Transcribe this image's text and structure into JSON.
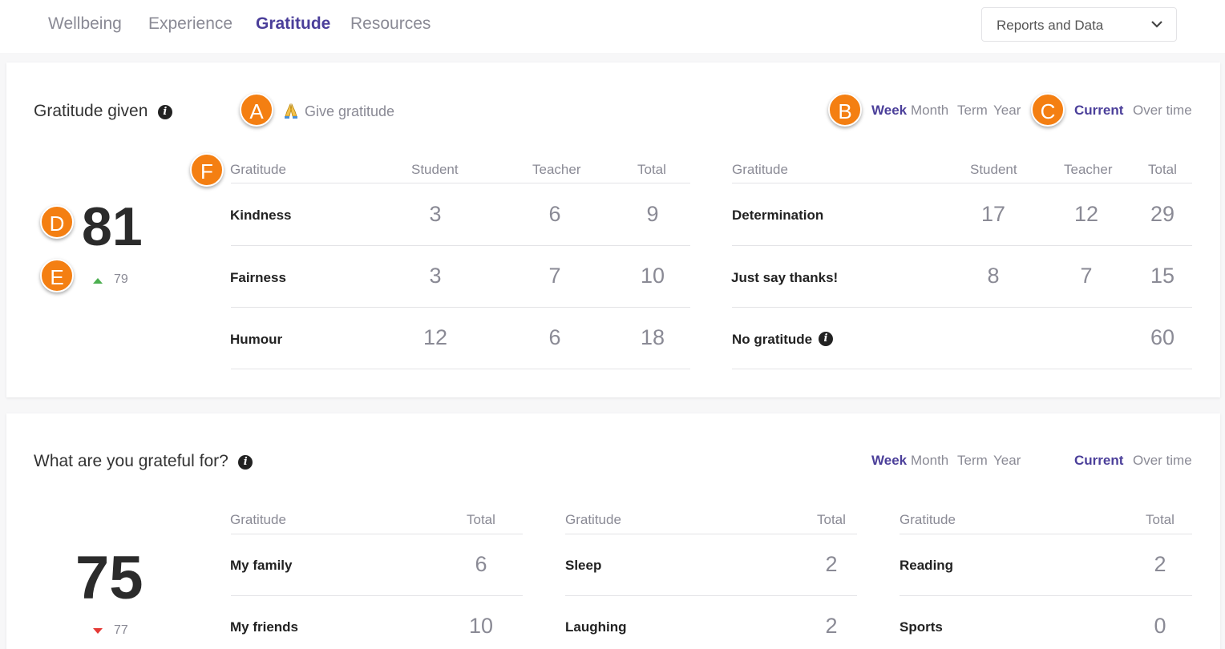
{
  "nav": {
    "tabs": [
      {
        "label": "Wellbeing",
        "active": false
      },
      {
        "label": "Experience",
        "active": false
      },
      {
        "label": "Gratitude",
        "active": true
      },
      {
        "label": "Resources",
        "active": false
      }
    ],
    "reports_dropdown": "Reports and Data"
  },
  "annotations": [
    "A",
    "B",
    "C",
    "D",
    "E",
    "F"
  ],
  "periods": [
    "Week",
    "Month",
    "Term",
    "Year"
  ],
  "modes": [
    "Current",
    "Over time"
  ],
  "gratitude_given": {
    "title": "Gratitude given",
    "give_label": "Give gratitude",
    "total": "81",
    "previous": "79",
    "trend": "up",
    "headers": [
      "Gratitude",
      "Student",
      "Teacher",
      "Total"
    ],
    "left_rows": [
      {
        "label": "Kindness",
        "student": "3",
        "teacher": "6",
        "total": "9"
      },
      {
        "label": "Fairness",
        "student": "3",
        "teacher": "7",
        "total": "10"
      },
      {
        "label": "Humour",
        "student": "12",
        "teacher": "6",
        "total": "18"
      }
    ],
    "right_rows": [
      {
        "label": "Determination",
        "student": "17",
        "teacher": "12",
        "total": "29"
      },
      {
        "label": "Just say thanks!",
        "student": "8",
        "teacher": "7",
        "total": "15"
      },
      {
        "label": "No gratitude",
        "student": "",
        "teacher": "",
        "total": "60"
      }
    ]
  },
  "grateful_for": {
    "title": "What are you grateful for?",
    "total": "75",
    "previous": "77",
    "trend": "down",
    "headers": [
      "Gratitude",
      "Total"
    ],
    "columns": [
      [
        {
          "label": "My family",
          "total": "6"
        },
        {
          "label": "My friends",
          "total": "10"
        }
      ],
      [
        {
          "label": "Sleep",
          "total": "2"
        },
        {
          "label": "Laughing",
          "total": "2"
        }
      ],
      [
        {
          "label": "Reading",
          "total": "2"
        },
        {
          "label": "Sports",
          "total": "0"
        }
      ]
    ]
  },
  "colors": {
    "accent": "#4b3f9a",
    "badge": "#f47f12",
    "up": "#4caf50",
    "down": "#e53935"
  }
}
